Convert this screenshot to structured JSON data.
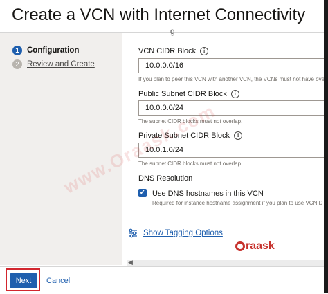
{
  "page": {
    "title": "Create a VCN with Internet Connectivity"
  },
  "steps": [
    {
      "number": "1",
      "label": "Configuration"
    },
    {
      "number": "2",
      "label": "Review and Create"
    }
  ],
  "form": {
    "vcn_cidr": {
      "label": "VCN CIDR Block",
      "value": "10.0.0.0/16",
      "help": "If you plan to peer this VCN with another VCN, the VCNs must not have ove"
    },
    "public_subnet": {
      "label": "Public Subnet CIDR Block",
      "value": "10.0.0.0/24",
      "help": "The subnet CIDR blocks must not overlap."
    },
    "private_subnet": {
      "label": "Private Subnet CIDR Block",
      "value": "10.0.1.0/24",
      "help": "The subnet CIDR blocks must not overlap."
    },
    "dns": {
      "section_label": "DNS Resolution",
      "checkbox_label": "Use DNS hostnames in this VCN",
      "checked": true,
      "help": "Required for instance hostname assignment if you plan to use VCN D"
    }
  },
  "tagging_link": "Show Tagging Options",
  "watermark": "www.Oraask.com",
  "logo_text": "raask",
  "footer": {
    "next_label": "Next",
    "cancel_label": "Cancel"
  },
  "colors": {
    "accent": "#1f5fae",
    "highlight": "#d2262e",
    "brand": "#c7322d"
  }
}
